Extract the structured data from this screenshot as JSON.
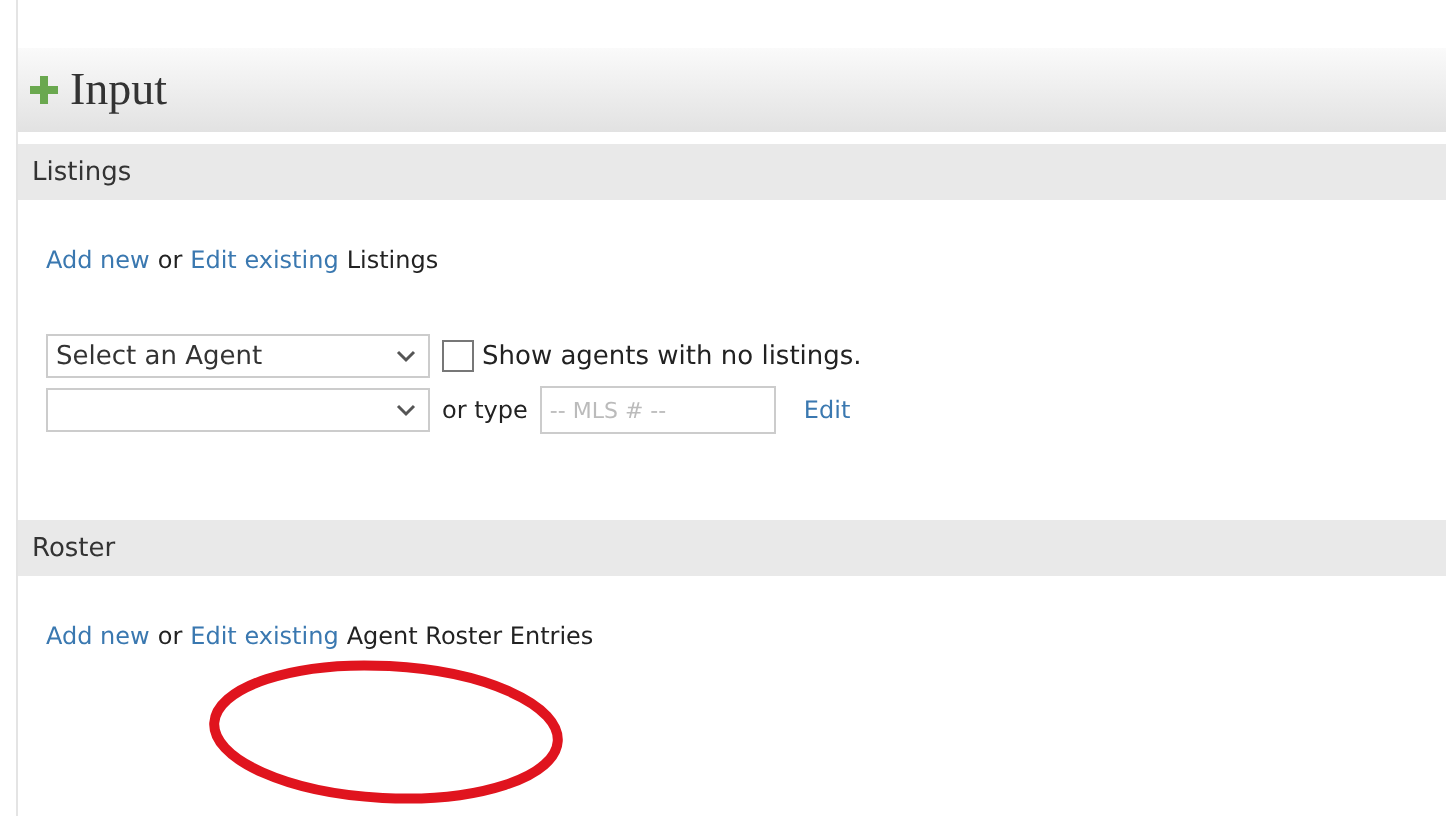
{
  "header": {
    "title": "Input"
  },
  "listings": {
    "title": "Listings",
    "sentence": [
      {
        "kind": "link",
        "text": "Add new"
      },
      {
        "kind": "text",
        "text": "or"
      },
      {
        "kind": "link",
        "text": "Edit existing"
      },
      {
        "kind": "text",
        "text": "Listings"
      }
    ],
    "agent_select": {
      "value": "Select an Agent"
    },
    "no_listings_checkbox": {
      "label": "Show agents with no listings.",
      "checked": false
    },
    "or_type_label": "or type",
    "mls_field": {
      "placeholder": "-- MLS # --"
    },
    "edit_link": "Edit"
  },
  "roster": {
    "title": "Roster",
    "sentence": [
      {
        "kind": "link",
        "text": "Add new"
      },
      {
        "kind": "text",
        "text": "or"
      },
      {
        "kind": "link",
        "text": "Edit existing"
      },
      {
        "kind": "text",
        "text": "Agent Roster Entries"
      }
    ]
  },
  "annotation": {
    "kind": "ellipse"
  }
}
